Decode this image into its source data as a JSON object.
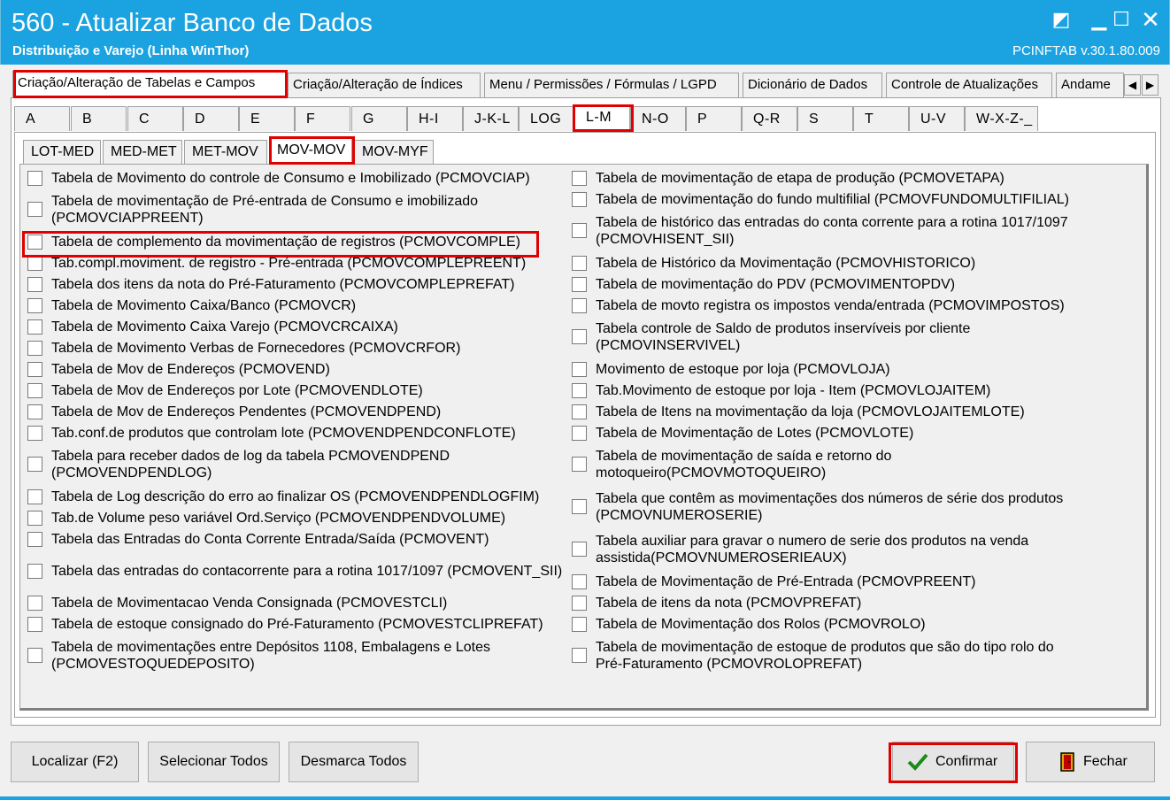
{
  "window": {
    "title": "560 - Atualizar Banco de Dados",
    "subtitle": "Distribuição e Varejo (Linha WinThor)",
    "version": "PCINFTAB  v.30.1.80.009",
    "controls": {
      "restore": "◩",
      "minimize": "▁",
      "maximize": "☐",
      "close": "✕"
    }
  },
  "main_tabs": [
    {
      "label": "Criação/Alteração de Tabelas e Campos",
      "active": true
    },
    {
      "label": "Criação/Alteração de Índices",
      "active": false
    },
    {
      "label": "Menu / Permissões / Fórmulas / LGPD",
      "active": false
    },
    {
      "label": "Dicionário de Dados",
      "active": false
    },
    {
      "label": "Controle de Atualizações",
      "active": false
    },
    {
      "label": "Andame",
      "active": false
    }
  ],
  "scroll_arrows": {
    "left": "◀",
    "right": "▶"
  },
  "letter_tabs": [
    "A",
    "B",
    "C",
    "D",
    "E",
    "F",
    "G",
    "H-I",
    "J-K-L",
    "LOG",
    "L-M",
    "N-O",
    "P",
    "Q-R",
    "S",
    "T",
    "U-V",
    "W-X-Z-_"
  ],
  "letter_tab_active": "L-M",
  "sub_tabs": [
    "LOT-MED",
    "MED-MET",
    "MET-MOV",
    "MOV-MOV",
    "MOV-MYF"
  ],
  "sub_tab_active": "MOV-MOV",
  "left_items": [
    [
      "Tabela de Movimento do controle de Consumo e Imobilizado (PCMOVCIAP)"
    ],
    [
      "Tabela de movimentação de Pré-entrada de Consumo e imobilizado",
      "(PCMOVCIAPPREENT)"
    ],
    [
      "Tabela de complemento da movimentação de registros (PCMOVCOMPLE)"
    ],
    [
      "Tab.compl.moviment. de registro - Pré-entrada (PCMOVCOMPLEPREENT)"
    ],
    [
      "Tabela dos itens da nota do Pré-Faturamento (PCMOVCOMPLEPREFAT)"
    ],
    [
      "Tabela de Movimento Caixa/Banco (PCMOVCR)"
    ],
    [
      "Tabela de Movimento Caixa Varejo (PCMOVCRCAIXA)"
    ],
    [
      "Tabela de Movimento Verbas de Fornecedores (PCMOVCRFOR)"
    ],
    [
      "Tabela de Mov de Endereços (PCMOVEND)"
    ],
    [
      "Tabela de Mov de Endereços por Lote (PCMOVENDLOTE)"
    ],
    [
      "Tabela de Mov de Endereços Pendentes (PCMOVENDPEND)"
    ],
    [
      "Tab.conf.de produtos que controlam lote (PCMOVENDPENDCONFLOTE)"
    ],
    [
      "Tabela para receber dados de log da tabela PCMOVENDPEND",
      "(PCMOVENDPENDLOG)"
    ],
    [
      "Tabela de Log descrição do erro ao finalizar OS (PCMOVENDPENDLOGFIM)"
    ],
    [
      "Tab.de Volume peso variável Ord.Serviço (PCMOVENDPENDVOLUME)"
    ],
    [
      "Tabela das Entradas do Conta Corrente Entrada/Saída (PCMOVENT)"
    ],
    [
      "Tabela das entradas do contacorrente para a rotina 1017/1097 (PCMOVENT_SII)"
    ],
    [
      "Tabela de Movimentacao Venda Consignada (PCMOVESTCLI)"
    ],
    [
      "Tabela de estoque consignado do Pré-Faturamento (PCMOVESTCLIPREFAT)"
    ],
    [
      "Tabela de movimentações entre Depósitos 1108, Embalagens e Lotes",
      "(PCMOVESTOQUEDEPOSITO)"
    ]
  ],
  "right_items": [
    [
      "Tabela de movimentação de etapa de produção (PCMOVETAPA)"
    ],
    [
      "Tabela de movimentação do fundo multifilial (PCMOVFUNDOMULTIFILIAL)"
    ],
    [
      "Tabela de histórico das entradas do conta corrente para a rotina 1017/1097",
      "(PCMOVHISENT_SII)"
    ],
    [
      "Tabela de Histórico da Movimentação (PCMOVHISTORICO)"
    ],
    [
      "Tabela de movimentação do PDV (PCMOVIMENTOPDV)"
    ],
    [
      "Tabela de movto registra os impostos venda/entrada (PCMOVIMPOSTOS)"
    ],
    [
      "Tabela controle de Saldo de produtos inservíveis por cliente",
      "(PCMOVINSERVIVEL)"
    ],
    [
      "Movimento de estoque por loja (PCMOVLOJA)"
    ],
    [
      "Tab.Movimento de estoque por loja - Item (PCMOVLOJAITEM)"
    ],
    [
      "Tabela de Itens na movimentação da loja (PCMOVLOJAITEMLOTE)"
    ],
    [
      "Tabela de Movimentação de Lotes (PCMOVLOTE)"
    ],
    [
      "Tabela de movimentação de saída e retorno do",
      "motoqueiro(PCMOVMOTOQUEIRO)"
    ],
    [
      "Tabela que contêm as movimentações dos números de série dos produtos",
      "(PCMOVNUMEROSERIE)"
    ],
    [
      "Tabela auxiliar para gravar o numero de serie dos produtos na venda",
      "assistida(PCMOVNUMEROSERIEAUX)"
    ],
    [
      "Tabela de Movimentação de Pré-Entrada (PCMOVPREENT)"
    ],
    [
      "Tabela de itens da nota (PCMOVPREFAT)"
    ],
    [
      "Tabela de Movimentação dos Rolos (PCMOVROLO)"
    ],
    [
      "Tabela de movimentação de estoque de produtos que são do tipo rolo do",
      "Pré-Faturamento (PCMOVROLOPREFAT)"
    ]
  ],
  "buttons": {
    "localizar": "Localizar (F2)",
    "selecionar_todos": "Selecionar Todos",
    "desmarca_todos": "Desmarca Todos",
    "confirmar": "Confirmar",
    "fechar": "Fechar"
  },
  "icons": {
    "confirm": "check-icon",
    "close": "exit-door-icon"
  },
  "colors": {
    "titlebar": "#1aa3e0",
    "highlight": "#e00000",
    "check": "#1b8a1b"
  }
}
